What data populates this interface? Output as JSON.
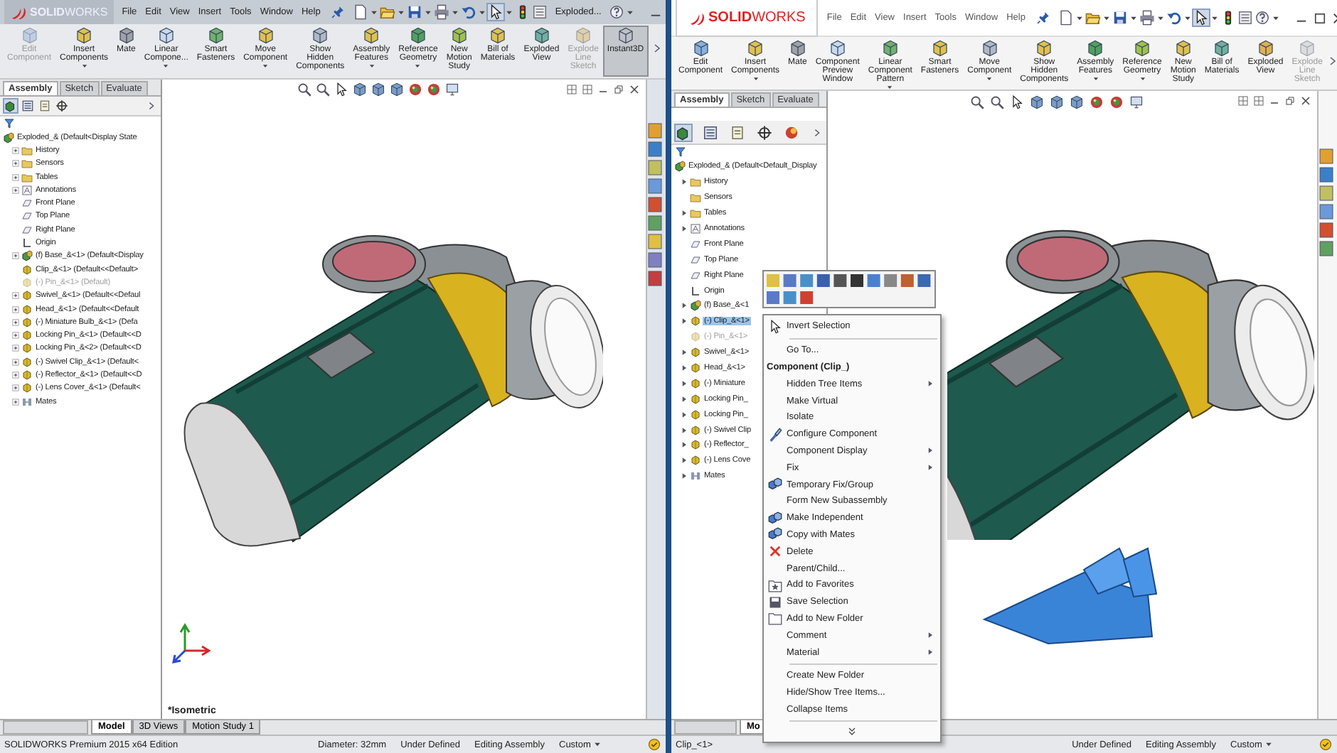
{
  "windows": [
    {
      "logo": "**SOLID**WORKS",
      "menu": [
        "File",
        "Edit",
        "View",
        "Insert",
        "Tools",
        "Window",
        "Help"
      ],
      "doc_title": "Exploded...",
      "ribbon": [
        {
          "label": "Edit Component",
          "disabled": true,
          "dropdown": false,
          "selected": false
        },
        {
          "label": "Insert Components",
          "disabled": false,
          "dropdown": true,
          "selected": false
        },
        {
          "label": "Mate",
          "disabled": false,
          "dropdown": false,
          "selected": false
        },
        {
          "label": "Linear Compone...",
          "disabled": false,
          "dropdown": true,
          "selected": false
        },
        {
          "label": "Smart Fasteners",
          "disabled": false,
          "dropdown": false,
          "selected": false
        },
        {
          "label": "Move Component",
          "disabled": false,
          "dropdown": true,
          "selected": false
        },
        {
          "label": "Show Hidden Components",
          "disabled": false,
          "dropdown": false,
          "selected": false
        },
        {
          "label": "Assembly Features",
          "disabled": false,
          "dropdown": true,
          "selected": false
        },
        {
          "label": "Reference Geometry",
          "disabled": false,
          "dropdown": true,
          "selected": false
        },
        {
          "label": "New Motion Study",
          "disabled": false,
          "dropdown": false,
          "selected": false
        },
        {
          "label": "Bill of Materials",
          "disabled": false,
          "dropdown": false,
          "selected": false
        },
        {
          "label": "Exploded View",
          "disabled": false,
          "dropdown": false,
          "selected": false
        },
        {
          "label": "Explode Line Sketch",
          "disabled": true,
          "dropdown": false,
          "selected": false
        },
        {
          "label": "Instant3D",
          "disabled": false,
          "dropdown": false,
          "selected": true
        }
      ],
      "command_tabs": [
        {
          "label": "Assembly",
          "selected": true
        },
        {
          "label": "Sketch",
          "selected": false
        },
        {
          "label": "Evaluate",
          "selected": false
        }
      ],
      "tree": {
        "label": "Exploded_& (Default<Display State",
        "kind": "assembly",
        "children": [
          {
            "label": "History",
            "kind": "folder",
            "expandable": true,
            "suppressed": false,
            "selected": false
          },
          {
            "label": "Sensors",
            "kind": "folder",
            "expandable": true,
            "suppressed": false,
            "selected": false
          },
          {
            "label": "Tables",
            "kind": "folder",
            "expandable": true,
            "suppressed": false,
            "selected": false
          },
          {
            "label": "Annotations",
            "kind": "annotations",
            "expandable": true,
            "suppressed": false,
            "selected": false
          },
          {
            "label": "Front Plane",
            "kind": "plane",
            "expandable": false,
            "suppressed": false,
            "selected": false
          },
          {
            "label": "Top Plane",
            "kind": "plane",
            "expandable": false,
            "suppressed": false,
            "selected": false
          },
          {
            "label": "Right Plane",
            "kind": "plane",
            "expandable": false,
            "suppressed": false,
            "selected": false
          },
          {
            "label": "Origin",
            "kind": "origin",
            "expandable": false,
            "suppressed": false,
            "selected": false
          },
          {
            "label": "(f) Base_&<1> (Default<Display",
            "kind": "assembly",
            "expandable": true,
            "suppressed": false,
            "selected": false
          },
          {
            "label": "Clip_&<1> (Default<<Default>",
            "kind": "part",
            "expandable": false,
            "suppressed": false,
            "selected": false
          },
          {
            "label": "(-) Pin_&<1> (Default)",
            "kind": "part",
            "expandable": false,
            "suppressed": true,
            "selected": false
          },
          {
            "label": "Swivel_&<1> (Default<<Defaul",
            "kind": "part",
            "expandable": true,
            "suppressed": false,
            "selected": false
          },
          {
            "label": "Head_&<1> (Default<<Default",
            "kind": "part",
            "expandable": true,
            "suppressed": false,
            "selected": false
          },
          {
            "label": "(-) Miniature Bulb_&<1> (Defa",
            "kind": "part",
            "expandable": true,
            "suppressed": false,
            "selected": false
          },
          {
            "label": "Locking Pin_&<1> (Default<<D",
            "kind": "part",
            "expandable": true,
            "suppressed": false,
            "selected": false
          },
          {
            "label": "Locking Pin_&<2> (Default<<D",
            "kind": "part",
            "expandable": true,
            "suppressed": false,
            "selected": false
          },
          {
            "label": "(-) Swivel Clip_&<1> (Default<",
            "kind": "part",
            "expandable": true,
            "suppressed": false,
            "selected": false
          },
          {
            "label": "(-) Reflector_&<1> (Default<<D",
            "kind": "part",
            "expandable": true,
            "suppressed": false,
            "selected": false
          },
          {
            "label": "(-) Lens Cover_&<1> (Default<",
            "kind": "part",
            "expandable": true,
            "suppressed": false,
            "selected": false
          },
          {
            "label": "Mates",
            "kind": "mates",
            "expandable": true,
            "suppressed": false,
            "selected": false
          }
        ]
      },
      "view_label": "*Isometric",
      "bottom_tabs": [
        {
          "label": "Model",
          "selected": true
        },
        {
          "label": "3D Views",
          "selected": false
        },
        {
          "label": "Motion Study 1",
          "selected": false
        }
      ],
      "status": [
        {
          "text": "SOLIDWORKS Premium 2015 x64 Edition",
          "dropdown": false
        },
        {
          "text": "Diameter: 32mm",
          "dropdown": false
        },
        {
          "text": "Under Defined",
          "dropdown": false
        },
        {
          "text": "Editing Assembly",
          "dropdown": false
        },
        {
          "text": "Custom",
          "dropdown": true
        }
      ]
    },
    {
      "logo": "**SOLID**WORKS",
      "menu": [
        "File",
        "Edit",
        "View",
        "Insert",
        "Tools",
        "Window",
        "Help"
      ],
      "ribbon": [
        {
          "label": "Edit Component",
          "disabled": false,
          "dropdown": false,
          "selected": false
        },
        {
          "label": "Insert Components",
          "disabled": false,
          "dropdown": true,
          "selected": false
        },
        {
          "label": "Mate",
          "disabled": false,
          "dropdown": false,
          "selected": false
        },
        {
          "label": "Component Preview Window",
          "disabled": false,
          "dropdown": false,
          "selected": false
        },
        {
          "label": "Linear Component Pattern",
          "disabled": false,
          "dropdown": true,
          "selected": false
        },
        {
          "label": "Smart Fasteners",
          "disabled": false,
          "dropdown": false,
          "selected": false
        },
        {
          "label": "Move Component",
          "disabled": false,
          "dropdown": true,
          "selected": false
        },
        {
          "label": "Show Hidden Components",
          "disabled": false,
          "dropdown": false,
          "selected": false
        },
        {
          "label": "Assembly Features",
          "disabled": false,
          "dropdown": true,
          "selected": false
        },
        {
          "label": "Reference Geometry",
          "disabled": false,
          "dropdown": true,
          "selected": false
        },
        {
          "label": "New Motion Study",
          "disabled": false,
          "dropdown": false,
          "selected": false
        },
        {
          "label": "Bill of Materials",
          "disabled": false,
          "dropdown": false,
          "selected": false
        },
        {
          "label": "Exploded View",
          "disabled": false,
          "dropdown": false,
          "selected": false
        },
        {
          "label": "Explode Line Sketch",
          "disabled": true,
          "dropdown": false,
          "selected": false
        }
      ],
      "command_tabs": [
        {
          "label": "Assembly",
          "selected": true
        },
        {
          "label": "Sketch",
          "selected": false
        },
        {
          "label": "Evaluate",
          "selected": false
        }
      ],
      "tree": {
        "label": "Exploded_& (Default<Default_Display",
        "kind": "assembly",
        "children": [
          {
            "label": "History",
            "kind": "folder",
            "expandable": true,
            "suppressed": false,
            "selected": false
          },
          {
            "label": "Sensors",
            "kind": "folder",
            "expandable": false,
            "suppressed": false,
            "selected": false
          },
          {
            "label": "Tables",
            "kind": "folder",
            "expandable": true,
            "suppressed": false,
            "selected": false
          },
          {
            "label": "Annotations",
            "kind": "annotations",
            "expandable": true,
            "suppressed": false,
            "selected": false
          },
          {
            "label": "Front Plane",
            "kind": "plane",
            "expandable": false,
            "suppressed": false,
            "selected": false
          },
          {
            "label": "Top Plane",
            "kind": "plane",
            "expandable": false,
            "suppressed": false,
            "selected": false
          },
          {
            "label": "Right Plane",
            "kind": "plane",
            "expandable": false,
            "suppressed": false,
            "selected": false
          },
          {
            "label": "Origin",
            "kind": "origin",
            "expandable": false,
            "suppressed": false,
            "selected": false
          },
          {
            "label": "(f) Base_&<1",
            "kind": "assembly",
            "expandable": true,
            "suppressed": false,
            "selected": false
          },
          {
            "label": "(-) Clip_&<1>",
            "kind": "part",
            "expandable": true,
            "suppressed": false,
            "selected": true
          },
          {
            "label": "(-) Pin_&<1>",
            "kind": "part",
            "expandable": false,
            "suppressed": true,
            "selected": false
          },
          {
            "label": "Swivel_&<1>",
            "kind": "part",
            "expandable": true,
            "suppressed": false,
            "selected": false
          },
          {
            "label": "Head_&<1>",
            "kind": "part",
            "expandable": true,
            "suppressed": false,
            "selected": false
          },
          {
            "label": "(-) Miniature",
            "kind": "part",
            "expandable": true,
            "suppressed": false,
            "selected": false
          },
          {
            "label": "Locking Pin_",
            "kind": "part",
            "expandable": true,
            "suppressed": false,
            "selected": false
          },
          {
            "label": "Locking Pin_",
            "kind": "part",
            "expandable": true,
            "suppressed": false,
            "selected": false
          },
          {
            "label": "(-) Swivel Clip",
            "kind": "part",
            "expandable": true,
            "suppressed": false,
            "selected": false
          },
          {
            "label": "(-) Reflector_",
            "kind": "part",
            "expandable": true,
            "suppressed": false,
            "selected": false
          },
          {
            "label": "(-) Lens Cove",
            "kind": "part",
            "expandable": true,
            "suppressed": false,
            "selected": false
          },
          {
            "label": "Mates",
            "kind": "mates",
            "expandable": true,
            "suppressed": false,
            "selected": false
          }
        ]
      },
      "context_menu": [
        {
          "kind": "item",
          "label": "Invert Selection",
          "submenu": false
        },
        {
          "kind": "separator"
        },
        {
          "kind": "item",
          "label": "Go To...",
          "submenu": false
        },
        {
          "kind": "header",
          "label": "Component (Clip_)"
        },
        {
          "kind": "item",
          "label": "Hidden Tree Items",
          "submenu": true
        },
        {
          "kind": "item",
          "label": "Make Virtual",
          "submenu": false
        },
        {
          "kind": "item",
          "label": "Isolate",
          "submenu": false
        },
        {
          "kind": "item",
          "label": "Configure Component",
          "submenu": false
        },
        {
          "kind": "item",
          "label": "Component Display",
          "submenu": true
        },
        {
          "kind": "item",
          "label": "Fix",
          "submenu": true
        },
        {
          "kind": "item",
          "label": "Temporary Fix/Group",
          "submenu": false
        },
        {
          "kind": "item",
          "label": "Form New Subassembly",
          "submenu": false
        },
        {
          "kind": "item",
          "label": "Make Independent",
          "submenu": false
        },
        {
          "kind": "item",
          "label": "Copy with Mates",
          "submenu": false
        },
        {
          "kind": "item",
          "label": "Delete",
          "submenu": false
        },
        {
          "kind": "item",
          "label": "Parent/Child...",
          "submenu": false
        },
        {
          "kind": "item",
          "label": "Add to Favorites",
          "submenu": false
        },
        {
          "kind": "item",
          "label": "Save Selection",
          "submenu": false
        },
        {
          "kind": "item",
          "label": "Add to New Folder",
          "submenu": false
        },
        {
          "kind": "item",
          "label": "Comment",
          "submenu": true
        },
        {
          "kind": "item",
          "label": "Material",
          "submenu": true
        },
        {
          "kind": "separator"
        },
        {
          "kind": "item",
          "label": "Create New Folder",
          "submenu": false
        },
        {
          "kind": "item",
          "label": "Hide/Show Tree Items...",
          "submenu": false
        },
        {
          "kind": "item",
          "label": "Collapse Items",
          "submenu": false
        },
        {
          "kind": "separator"
        },
        {
          "kind": "more"
        }
      ],
      "bottom_tabs": [
        {
          "label": "Mo",
          "selected": true
        }
      ],
      "status": [
        {
          "text": "Clip_<1>",
          "dropdown": false
        },
        {
          "text": "Under Defined",
          "dropdown": false
        },
        {
          "text": "Editing Assembly",
          "dropdown": false
        },
        {
          "text": "Custom",
          "dropdown": true
        }
      ]
    }
  ]
}
